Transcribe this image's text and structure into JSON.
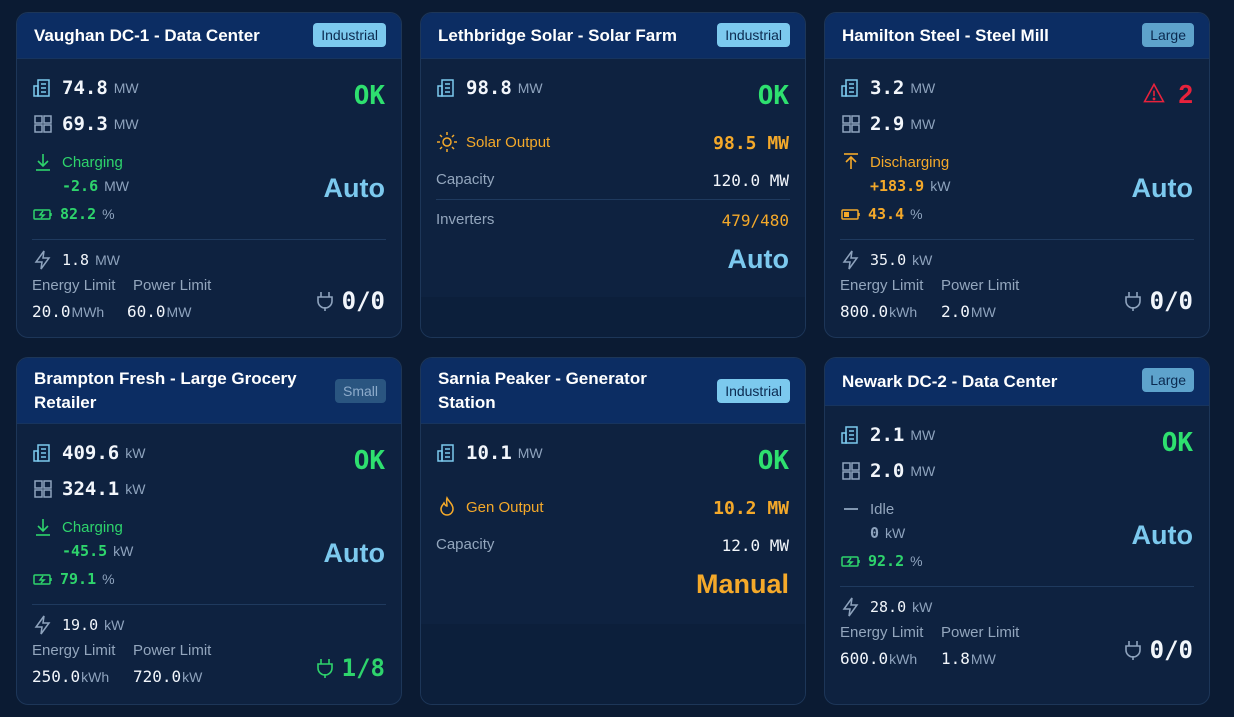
{
  "cards": [
    {
      "title": "Vaughan DC-1 - Data Center",
      "badge": "Industrial",
      "load": "74.8",
      "load_unit": "MW",
      "net": "69.3",
      "net_unit": "MW",
      "status": "OK",
      "battery_state": "Charging",
      "battery_power": "-2.6",
      "battery_power_unit": "MW",
      "soc": "82.2",
      "soc_unit": "%",
      "mode": "Auto",
      "flex": "1.8",
      "flex_unit": "MW",
      "energy_limit_label": "Energy Limit",
      "power_limit_label": "Power Limit",
      "energy_limit": "20.0",
      "energy_limit_unit": "MWh",
      "power_limit": "60.0",
      "power_limit_unit": "MW",
      "chargers": "0/0"
    },
    {
      "title": "Lethbridge Solar - Solar Farm",
      "badge": "Industrial",
      "load": "98.8",
      "load_unit": "MW",
      "status": "OK",
      "output_label": "Solar Output",
      "output_value": "98.5 MW",
      "capacity_label": "Capacity",
      "capacity_value": "120.0 MW",
      "inverters_label": "Inverters",
      "inverters_value": "479/480",
      "mode": "Auto"
    },
    {
      "title": "Hamilton Steel - Steel Mill",
      "badge": "Large",
      "load": "3.2",
      "load_unit": "MW",
      "net": "2.9",
      "net_unit": "MW",
      "alert_count": "2",
      "battery_state": "Discharging",
      "battery_power": "+183.9",
      "battery_power_unit": "kW",
      "soc": "43.4",
      "soc_unit": "%",
      "mode": "Auto",
      "flex": "35.0",
      "flex_unit": "kW",
      "energy_limit_label": "Energy Limit",
      "power_limit_label": "Power Limit",
      "energy_limit": "800.0",
      "energy_limit_unit": "kWh",
      "power_limit": "2.0",
      "power_limit_unit": "MW",
      "chargers": "0/0"
    },
    {
      "title_line1": "Brampton Fresh - Large Grocery",
      "title_line2": "Retailer",
      "badge": "Small",
      "load": "409.6",
      "load_unit": "kW",
      "net": "324.1",
      "net_unit": "kW",
      "status": "OK",
      "battery_state": "Charging",
      "battery_power": "-45.5",
      "battery_power_unit": "kW",
      "soc": "79.1",
      "soc_unit": "%",
      "mode": "Auto",
      "flex": "19.0",
      "flex_unit": "kW",
      "energy_limit_label": "Energy Limit",
      "power_limit_label": "Power Limit",
      "energy_limit": "250.0",
      "energy_limit_unit": "kWh",
      "power_limit": "720.0",
      "power_limit_unit": "kW",
      "chargers": "1/8"
    },
    {
      "title_line1": "Sarnia Peaker - Generator",
      "title_line2": "Station",
      "badge": "Industrial",
      "load": "10.1",
      "load_unit": "MW",
      "status": "OK",
      "output_label": "Gen Output",
      "output_value": "10.2 MW",
      "capacity_label": "Capacity",
      "capacity_value": "12.0 MW",
      "mode": "Manual"
    },
    {
      "title": "Newark DC-2 - Data Center",
      "badge": "Large",
      "load": "2.1",
      "load_unit": "MW",
      "net": "2.0",
      "net_unit": "MW",
      "status": "OK",
      "battery_state": "Idle",
      "battery_power": "0",
      "battery_power_unit": "kW",
      "soc": "92.2",
      "soc_unit": "%",
      "mode": "Auto",
      "flex": "28.0",
      "flex_unit": "kW",
      "energy_limit_label": "Energy Limit",
      "power_limit_label": "Power Limit",
      "energy_limit": "600.0",
      "energy_limit_unit": "kWh",
      "power_limit": "1.8",
      "power_limit_unit": "MW",
      "chargers": "0/0"
    }
  ],
  "colors": {
    "ok": "#2ee06f",
    "auto": "#7cc9ee",
    "manual": "#f4a92a",
    "alert": "#e8223c",
    "charging": "#2ed46c",
    "discharging": "#f4a92a"
  },
  "icons": [
    "building-icon",
    "grid-icon",
    "charging-arrow-icon",
    "discharging-arrow-icon",
    "idle-dash-icon",
    "battery-icon",
    "bolt-icon",
    "plug-icon",
    "sun-icon",
    "flame-icon",
    "warning-icon"
  ]
}
